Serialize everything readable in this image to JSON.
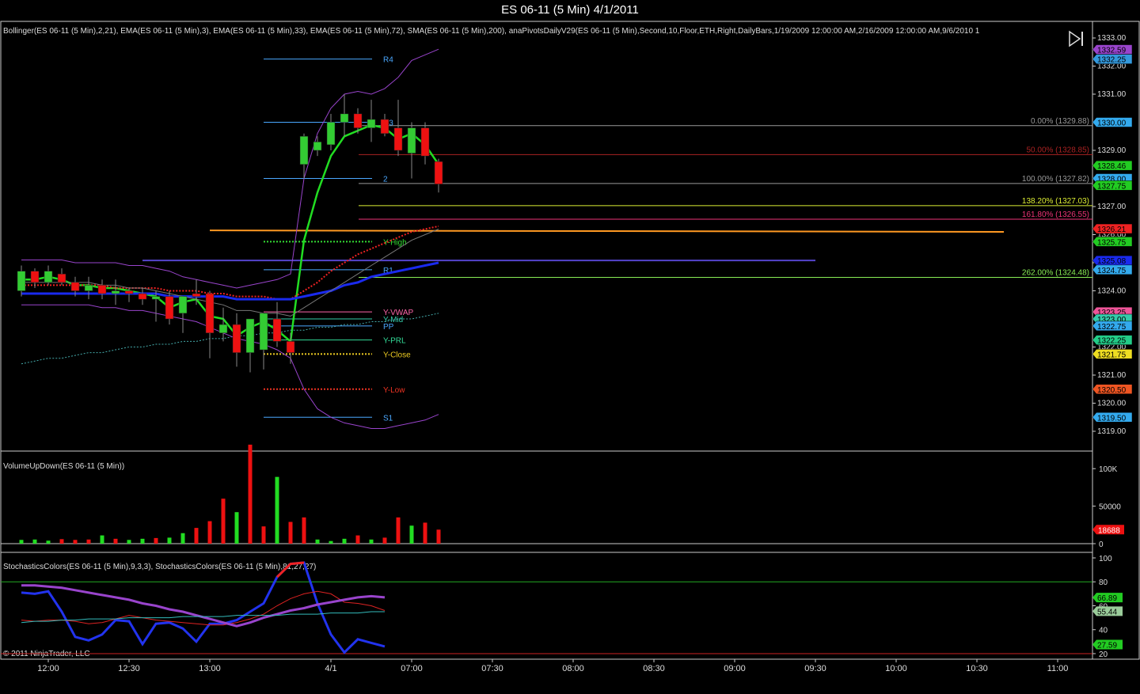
{
  "window": {
    "title": "ES 06-11 (5 Min)  4/1/2011"
  },
  "panels": {
    "price_label": "Bollinger(ES 06-11 (5 Min),2,21), EMA(ES 06-11 (5 Min),3), EMA(ES 06-11 (5 Min),33), EMA(ES 06-11 (5 Min),72), SMA(ES 06-11 (5 Min),200), anaPivotsDailyV29(ES 06-11 (5 Min),Second,10,Floor,ETH,Right,DailyBars,1/19/2009 12:00:00 AM,2/16/2009 12:00:00 AM,9/6/2010 1",
    "volume_label": "VolumeUpDown(ES 06-11 (5 Min))",
    "stoch_label": "StochasticsColors(ES 06-11 (5 Min),9,3,3), StochasticsColors(ES 06-11 (5 Min),81,27,27)",
    "copyright": "© 2011 NinjaTrader, LLC"
  },
  "chart_data": [
    {
      "type": "candlestick",
      "panel": "price",
      "ylim": [
        1318.5,
        1333.2
      ],
      "y_ticks": [
        "1333.00",
        "1332.00",
        "1331.00",
        "1330.00",
        "1329.00",
        "1328.00",
        "1327.00",
        "1326.00",
        "1325.00",
        "1324.00",
        "1323.00",
        "1322.00",
        "1321.00",
        "1320.00",
        "1319.00"
      ],
      "x_ticks": [
        "12:00",
        "12:30",
        "13:00",
        "4/1",
        "07:00",
        "07:30",
        "08:00",
        "08:30",
        "09:00",
        "09:30",
        "10:00",
        "10:30",
        "11:00"
      ],
      "candles": [
        {
          "o": 1324.0,
          "h": 1324.9,
          "l": 1323.8,
          "c": 1324.7,
          "up": true
        },
        {
          "o": 1324.7,
          "h": 1324.8,
          "l": 1324.1,
          "c": 1324.3,
          "up": false
        },
        {
          "o": 1324.3,
          "h": 1324.9,
          "l": 1324.2,
          "c": 1324.7,
          "up": true
        },
        {
          "o": 1324.6,
          "h": 1324.8,
          "l": 1324.2,
          "c": 1324.3,
          "up": false
        },
        {
          "o": 1324.3,
          "h": 1324.5,
          "l": 1323.8,
          "c": 1324.0,
          "up": false
        },
        {
          "o": 1324.0,
          "h": 1324.5,
          "l": 1323.7,
          "c": 1324.2,
          "up": true
        },
        {
          "o": 1324.2,
          "h": 1324.4,
          "l": 1323.7,
          "c": 1323.9,
          "up": false
        },
        {
          "o": 1323.9,
          "h": 1324.4,
          "l": 1323.5,
          "c": 1324.0,
          "up": true
        },
        {
          "o": 1324.0,
          "h": 1324.1,
          "l": 1323.6,
          "c": 1323.9,
          "up": false
        },
        {
          "o": 1323.9,
          "h": 1324.1,
          "l": 1323.5,
          "c": 1323.7,
          "up": false
        },
        {
          "o": 1323.7,
          "h": 1324.0,
          "l": 1322.9,
          "c": 1323.8,
          "up": true
        },
        {
          "o": 1323.8,
          "h": 1324.0,
          "l": 1322.8,
          "c": 1323.0,
          "up": false
        },
        {
          "o": 1323.2,
          "h": 1323.8,
          "l": 1322.5,
          "c": 1323.8,
          "up": true
        },
        {
          "o": 1323.8,
          "h": 1324.4,
          "l": 1323.5,
          "c": 1323.9,
          "up": false
        },
        {
          "o": 1323.9,
          "h": 1324.0,
          "l": 1321.6,
          "c": 1322.5,
          "up": false
        },
        {
          "o": 1322.5,
          "h": 1323.4,
          "l": 1322.2,
          "c": 1322.8,
          "up": true
        },
        {
          "o": 1322.8,
          "h": 1323.2,
          "l": 1321.3,
          "c": 1321.8,
          "up": false
        },
        {
          "o": 1321.8,
          "h": 1323.0,
          "l": 1321.1,
          "c": 1323.0,
          "up": true
        },
        {
          "o": 1321.9,
          "h": 1323.2,
          "l": 1321.2,
          "c": 1323.2,
          "up": true
        },
        {
          "o": 1323.0,
          "h": 1323.6,
          "l": 1322.0,
          "c": 1322.2,
          "up": false
        },
        {
          "o": 1322.2,
          "h": 1322.5,
          "l": 1321.4,
          "c": 1321.8,
          "up": false
        },
        {
          "o": 1328.5,
          "h": 1329.6,
          "l": 1328.0,
          "c": 1329.5,
          "up": true
        },
        {
          "o": 1329.0,
          "h": 1329.5,
          "l": 1328.8,
          "c": 1329.3,
          "up": true
        },
        {
          "o": 1329.2,
          "h": 1330.3,
          "l": 1329.0,
          "c": 1330.0,
          "up": true
        },
        {
          "o": 1330.0,
          "h": 1331.0,
          "l": 1329.5,
          "c": 1330.3,
          "up": true
        },
        {
          "o": 1330.3,
          "h": 1330.5,
          "l": 1329.6,
          "c": 1329.8,
          "up": false
        },
        {
          "o": 1329.8,
          "h": 1330.8,
          "l": 1329.3,
          "c": 1330.1,
          "up": true
        },
        {
          "o": 1330.1,
          "h": 1330.3,
          "l": 1329.5,
          "c": 1329.6,
          "up": false
        },
        {
          "o": 1329.8,
          "h": 1330.8,
          "l": 1328.8,
          "c": 1329.0,
          "up": false
        },
        {
          "o": 1328.9,
          "h": 1330.0,
          "l": 1328.0,
          "c": 1329.8,
          "up": true
        },
        {
          "o": 1329.8,
          "h": 1330.0,
          "l": 1328.5,
          "c": 1328.8,
          "up": false
        },
        {
          "o": 1328.6,
          "h": 1328.7,
          "l": 1327.5,
          "c": 1327.8,
          "up": false
        }
      ],
      "series": [
        {
          "name": "EMA 3",
          "color": "#22dd22",
          "values": [
            1324.4,
            1324.4,
            1324.5,
            1324.4,
            1324.2,
            1324.2,
            1324.1,
            1324.1,
            1324.0,
            1323.9,
            1323.8,
            1323.4,
            1323.6,
            1323.7,
            1323.1,
            1323.0,
            1322.4,
            1322.7,
            1322.9,
            1322.6,
            1322.2,
            1325.8,
            1327.5,
            1328.8,
            1329.5,
            1329.7,
            1329.9,
            1329.8,
            1329.4,
            1329.6,
            1329.2,
            1328.5
          ]
        },
        {
          "name": "EMA 33",
          "color": "#ee2222",
          "values": [
            1324.2,
            1324.2,
            1324.2,
            1324.2,
            1324.2,
            1324.2,
            1324.2,
            1324.1,
            1324.1,
            1324.1,
            1324.1,
            1324.0,
            1324.0,
            1324.0,
            1323.9,
            1323.9,
            1323.8,
            1323.8,
            1323.8,
            1323.7,
            1323.7,
            1324.0,
            1324.3,
            1324.7,
            1325.0,
            1325.3,
            1325.5,
            1325.7,
            1325.9,
            1326.1,
            1326.2,
            1326.3
          ]
        },
        {
          "name": "EMA 72",
          "color": "#1a2aee",
          "values": [
            1323.9,
            1323.9,
            1323.9,
            1323.9,
            1323.9,
            1323.9,
            1323.9,
            1323.9,
            1323.9,
            1323.9,
            1323.9,
            1323.8,
            1323.8,
            1323.8,
            1323.8,
            1323.8,
            1323.7,
            1323.7,
            1323.7,
            1323.7,
            1323.7,
            1323.8,
            1323.9,
            1324.0,
            1324.2,
            1324.3,
            1324.5,
            1324.6,
            1324.7,
            1324.8,
            1324.9,
            1325.0
          ]
        },
        {
          "name": "SMA 200",
          "color": "#44aaaa",
          "values": [
            1321.4,
            1321.5,
            1321.6,
            1321.6,
            1321.7,
            1321.8,
            1321.8,
            1321.9,
            1322.0,
            1322.0,
            1322.1,
            1322.1,
            1322.2,
            1322.2,
            1322.3,
            1322.3,
            1322.4,
            1322.4,
            1322.5,
            1322.5,
            1322.6,
            1322.6,
            1322.7,
            1322.7,
            1322.8,
            1322.8,
            1322.9,
            1322.9,
            1323.0,
            1323.0,
            1323.1,
            1323.2
          ]
        },
        {
          "name": "Bollinger Upper",
          "color": "#9944cc",
          "values": [
            1325.1,
            1325.1,
            1325.1,
            1325.1,
            1325.0,
            1325.0,
            1325.0,
            1325.0,
            1324.9,
            1324.9,
            1324.8,
            1324.7,
            1324.5,
            1324.4,
            1324.3,
            1324.2,
            1324.1,
            1324.2,
            1324.3,
            1324.4,
            1324.6,
            1328.0,
            1329.6,
            1330.5,
            1331.0,
            1331.1,
            1331.0,
            1331.2,
            1331.6,
            1332.2,
            1332.4,
            1332.6
          ]
        },
        {
          "name": "Bollinger Middle",
          "color": "#777777",
          "values": [
            1324.3,
            1324.3,
            1324.3,
            1324.3,
            1324.3,
            1324.3,
            1324.2,
            1324.2,
            1324.1,
            1324.1,
            1324.0,
            1323.9,
            1323.8,
            1323.7,
            1323.6,
            1323.5,
            1323.3,
            1323.3,
            1323.2,
            1323.2,
            1323.1,
            1323.4,
            1323.7,
            1324.0,
            1324.3,
            1324.6,
            1324.9,
            1325.2,
            1325.5,
            1325.8,
            1326.0,
            1326.2
          ]
        },
        {
          "name": "Bollinger Lower",
          "color": "#9944cc",
          "values": [
            1323.5,
            1323.5,
            1323.5,
            1323.5,
            1323.5,
            1323.5,
            1323.4,
            1323.4,
            1323.3,
            1323.3,
            1323.2,
            1323.1,
            1323.0,
            1322.9,
            1322.7,
            1322.5,
            1322.3,
            1322.2,
            1322.1,
            1321.9,
            1321.6,
            1320.5,
            1319.8,
            1319.5,
            1319.3,
            1319.2,
            1319.1,
            1319.1,
            1319.2,
            1319.3,
            1319.4,
            1319.6
          ]
        }
      ],
      "pivot_labels": [
        {
          "label": "R4",
          "value": 1332.25,
          "color": "#4aa8ff"
        },
        {
          "label": "R3",
          "value": 1330.0,
          "color": "#4aa8ff"
        },
        {
          "label": "2",
          "value": 1328.0,
          "color": "#4aa8ff"
        },
        {
          "label": "Y-High",
          "value": 1325.75,
          "color": "#33dd33"
        },
        {
          "label": "R1",
          "value": 1324.75,
          "color": "#4aa8ff"
        },
        {
          "label": "Y-VWAP",
          "value": 1323.25,
          "color": "#ff66aa"
        },
        {
          "label": "Y-Mid",
          "value": 1323.0,
          "color": "#33ccaa"
        },
        {
          "label": "PP",
          "value": 1322.75,
          "color": "#4aa8ff"
        },
        {
          "label": "Y-PRL",
          "value": 1322.25,
          "color": "#33dd99"
        },
        {
          "label": "Y-Close",
          "value": 1321.75,
          "color": "#eecc22"
        },
        {
          "label": "Y-Low",
          "value": 1320.5,
          "color": "#ee3322"
        },
        {
          "label": "S1",
          "value": 1319.5,
          "color": "#4aa8ff"
        }
      ],
      "fib_levels": [
        {
          "label": "0.00% (1329.88)",
          "value": 1329.88,
          "color": "#999999"
        },
        {
          "label": "50.00% (1328.85)",
          "value": 1328.85,
          "color": "#aa2222"
        },
        {
          "label": "100.00% (1327.82)",
          "value": 1327.82,
          "color": "#999999"
        },
        {
          "label": "138.20% (1327.03)",
          "value": 1327.03,
          "color": "#ddee33"
        },
        {
          "label": "161.80% (1326.55)",
          "value": 1326.55,
          "color": "#ee3377"
        },
        {
          "label": "262.00% (1324.48)",
          "value": 1324.48,
          "color": "#88ee55"
        }
      ],
      "price_tags": [
        {
          "text": "1332.59",
          "value": 1332.59,
          "color": "#9944cc"
        },
        {
          "text": "1332.25",
          "value": 1332.25,
          "color": "#3399dd"
        },
        {
          "text": "1330.00",
          "value": 1330.0,
          "color": "#33aaee"
        },
        {
          "text": "1328.46",
          "value": 1328.46,
          "color": "#22cc22"
        },
        {
          "text": "1328.00",
          "value": 1328.0,
          "color": "#33aaee"
        },
        {
          "text": "1327.75",
          "value": 1327.75,
          "color": "#22cc22"
        },
        {
          "text": "1326.21",
          "value": 1326.21,
          "color": "#ee2222"
        },
        {
          "text": "1325.75",
          "value": 1325.75,
          "color": "#22cc22"
        },
        {
          "text": "1325.08",
          "value": 1325.08,
          "color": "#1a2aee"
        },
        {
          "text": "1324.75",
          "value": 1324.75,
          "color": "#33aaee"
        },
        {
          "text": "1323.25",
          "value": 1323.25,
          "color": "#ee5599"
        },
        {
          "text": "1323.00",
          "value": 1323.0,
          "color": "#33ccaa"
        },
        {
          "text": "1322.75",
          "value": 1322.75,
          "color": "#33aaee"
        },
        {
          "text": "1322.25",
          "value": 1322.25,
          "color": "#22cc88"
        },
        {
          "text": "1321.75",
          "value": 1321.75,
          "color": "#eedd22"
        },
        {
          "text": "1320.50",
          "value": 1320.5,
          "color": "#ee5522"
        },
        {
          "text": "1319.50",
          "value": 1319.5,
          "color": "#33aaee"
        }
      ]
    },
    {
      "type": "bar",
      "panel": "volume",
      "ylim": [
        0,
        115000
      ],
      "y_ticks": [
        "100K",
        "50000",
        "0"
      ],
      "last_value": "18688",
      "values": [
        5000,
        5500,
        4000,
        6000,
        5000,
        5500,
        11000,
        6500,
        5000,
        6500,
        7500,
        8000,
        14000,
        21000,
        30000,
        60000,
        42000,
        132000,
        23000,
        89000,
        29000,
        35000,
        5500,
        3500,
        6500,
        11000,
        5500,
        8000,
        35000,
        24000,
        28000,
        18688
      ],
      "up": [
        true,
        true,
        true,
        false,
        false,
        false,
        true,
        false,
        true,
        true,
        false,
        true,
        true,
        false,
        false,
        false,
        true,
        false,
        false,
        true,
        false,
        false,
        true,
        true,
        true,
        false,
        true,
        false,
        false,
        true,
        false,
        false
      ]
    },
    {
      "type": "line",
      "panel": "stochastics",
      "ylim": [
        18,
        100
      ],
      "y_ticks": [
        "100",
        "80",
        "60",
        "40",
        "20"
      ],
      "series": [
        {
          "name": "Stoch 9 D",
          "color": "#2233ee",
          "values": [
            71,
            70,
            72,
            55,
            34,
            31,
            36,
            48,
            47,
            28,
            45,
            46,
            41,
            30,
            45,
            45,
            48,
            55,
            62,
            84,
            95,
            96,
            62,
            36,
            21,
            32,
            29,
            26
          ]
        },
        {
          "name": "Stoch 9 K",
          "color": "#dd2222",
          "values": [
            48,
            47,
            48,
            48,
            47,
            45,
            46,
            49,
            52,
            50,
            48,
            47,
            46,
            45,
            44,
            44,
            46,
            49,
            53,
            60,
            66,
            70,
            72,
            70,
            63,
            62,
            60,
            56
          ]
        },
        {
          "name": "Stoch 81 D",
          "color": "#9944cc",
          "values": [
            77,
            77,
            76,
            75,
            73,
            71,
            69,
            67,
            65,
            62,
            60,
            57,
            55,
            52,
            49,
            46,
            43,
            46,
            50,
            53,
            56,
            58,
            61,
            63,
            65,
            67,
            68,
            67
          ]
        },
        {
          "name": "Stoch 81 K",
          "color": "#33bbbb",
          "values": [
            46,
            47,
            47,
            48,
            48,
            49,
            49,
            49,
            50,
            50,
            50,
            50,
            51,
            51,
            51,
            51,
            52,
            52,
            52,
            52,
            53,
            53,
            53,
            54,
            54,
            54,
            55,
            55
          ]
        }
      ],
      "tags": [
        {
          "text": "66.89",
          "value": 66.89,
          "color": "#22cc22"
        },
        {
          "text": "55.44",
          "value": 55.44,
          "color": "#9acc9a"
        },
        {
          "text": "27.59",
          "value": 27.59,
          "color": "#22cc22"
        }
      ]
    }
  ]
}
